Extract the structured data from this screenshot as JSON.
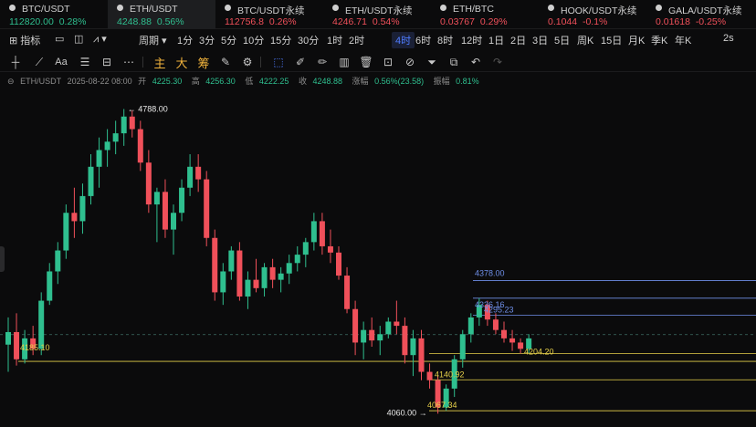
{
  "tickers": [
    {
      "symbol": "BTC/USDT",
      "price": "112820.00",
      "change": "0.28%",
      "dir": "up"
    },
    {
      "symbol": "ETH/USDT",
      "price": "4248.88",
      "change": "0.56%",
      "dir": "up"
    },
    {
      "symbol": "BTC/USDT永续",
      "price": "112756.8",
      "change": "0.26%",
      "dir": "dn"
    },
    {
      "symbol": "ETH/USDT永续",
      "price": "4246.71",
      "change": "0.54%",
      "dir": "dn"
    },
    {
      "symbol": "ETH/BTC",
      "price": "0.03767",
      "change": "0.29%",
      "dir": "dn"
    },
    {
      "symbol": "HOOK/USDT永续",
      "price": "0.1044",
      "change": "-0.1%",
      "dir": "dn"
    },
    {
      "symbol": "GALA/USDT永续",
      "price": "0.01618",
      "change": "-0.25%",
      "dir": "dn"
    }
  ],
  "toolbar": {
    "indicator_label": "指标",
    "period_label": "周期",
    "intervals": [
      "1分",
      "3分",
      "5分",
      "10分",
      "15分",
      "30分",
      "1时",
      "2时",
      "4时",
      "6时",
      "8时",
      "12时",
      "1日",
      "2日",
      "3日",
      "5日",
      "周K",
      "15日",
      "月K",
      "季K",
      "年K"
    ],
    "active_interval": "4时",
    "refresh": "2s",
    "draw_main": "主",
    "draw_big": "大",
    "draw_chip": "筹"
  },
  "ohlc": {
    "symbol": "ETH/USDT",
    "time": "2025-08-22 08:00",
    "open_label": "开",
    "open": "4225.30",
    "high_label": "高",
    "high": "4256.30",
    "low_label": "低",
    "low": "4222.25",
    "close_label": "收",
    "close": "4248.88",
    "change_label": "涨幅",
    "change": "0.56%(23.58)",
    "amp_label": "振幅",
    "amp": "0.81%"
  },
  "chart_data": {
    "type": "candlestick",
    "price_range": [
      4050,
      4800
    ],
    "price_ticks": [],
    "candles": [
      [
        4225,
        4290,
        4160,
        4255
      ],
      [
        4255,
        4300,
        4175,
        4190
      ],
      [
        4190,
        4260,
        4180,
        4240
      ],
      [
        4240,
        4270,
        4200,
        4215
      ],
      [
        4215,
        4350,
        4200,
        4330
      ],
      [
        4330,
        4420,
        4320,
        4400
      ],
      [
        4400,
        4470,
        4370,
        4450
      ],
      [
        4450,
        4560,
        4430,
        4540
      ],
      [
        4540,
        4600,
        4480,
        4520
      ],
      [
        4520,
        4610,
        4490,
        4580
      ],
      [
        4580,
        4680,
        4560,
        4650
      ],
      [
        4650,
        4720,
        4600,
        4690
      ],
      [
        4690,
        4740,
        4650,
        4710
      ],
      [
        4710,
        4760,
        4680,
        4730
      ],
      [
        4730,
        4788,
        4700,
        4770
      ],
      [
        4770,
        4785,
        4720,
        4740
      ],
      [
        4740,
        4760,
        4640,
        4660
      ],
      [
        4660,
        4690,
        4540,
        4560
      ],
      [
        4560,
        4600,
        4470,
        4590
      ],
      [
        4590,
        4620,
        4480,
        4500
      ],
      [
        4500,
        4560,
        4440,
        4540
      ],
      [
        4540,
        4620,
        4520,
        4600
      ],
      [
        4600,
        4680,
        4580,
        4650
      ],
      [
        4650,
        4680,
        4590,
        4620
      ],
      [
        4620,
        4640,
        4460,
        4480
      ],
      [
        4480,
        4500,
        4330,
        4350
      ],
      [
        4350,
        4420,
        4320,
        4400
      ],
      [
        4400,
        4460,
        4380,
        4450
      ],
      [
        4450,
        4470,
        4330,
        4340
      ],
      [
        4340,
        4400,
        4310,
        4380
      ],
      [
        4380,
        4430,
        4350,
        4360
      ],
      [
        4360,
        4420,
        4340,
        4410
      ],
      [
        4410,
        4430,
        4360,
        4380
      ],
      [
        4380,
        4410,
        4350,
        4395
      ],
      [
        4395,
        4440,
        4370,
        4420
      ],
      [
        4420,
        4460,
        4400,
        4440
      ],
      [
        4440,
        4480,
        4410,
        4470
      ],
      [
        4470,
        4540,
        4450,
        4520
      ],
      [
        4520,
        4540,
        4440,
        4460
      ],
      [
        4460,
        4500,
        4420,
        4445
      ],
      [
        4445,
        4460,
        4380,
        4390
      ],
      [
        4390,
        4410,
        4300,
        4310
      ],
      [
        4310,
        4330,
        4200,
        4230
      ],
      [
        4230,
        4280,
        4190,
        4260
      ],
      [
        4260,
        4290,
        4220,
        4235
      ],
      [
        4235,
        4270,
        4200,
        4250
      ],
      [
        4250,
        4290,
        4240,
        4280
      ],
      [
        4280,
        4330,
        4250,
        4270
      ],
      [
        4270,
        4290,
        4180,
        4200
      ],
      [
        4200,
        4260,
        4150,
        4240
      ],
      [
        4240,
        4260,
        4140,
        4160
      ],
      [
        4160,
        4180,
        4120,
        4140
      ],
      [
        4140,
        4150,
        4060,
        4075
      ],
      [
        4075,
        4130,
        4067,
        4120
      ],
      [
        4120,
        4200,
        4100,
        4190
      ],
      [
        4190,
        4260,
        4170,
        4250
      ],
      [
        4250,
        4300,
        4230,
        4290
      ],
      [
        4290,
        4336,
        4270,
        4320
      ],
      [
        4320,
        4330,
        4270,
        4285
      ],
      [
        4285,
        4300,
        4250,
        4260
      ],
      [
        4260,
        4280,
        4230,
        4240
      ],
      [
        4240,
        4260,
        4210,
        4230
      ],
      [
        4230,
        4240,
        4204,
        4215
      ],
      [
        4215,
        4250,
        4205,
        4240
      ]
    ],
    "levels": [
      {
        "label": "4378.00",
        "price": 4378,
        "color": "#6f8fe8"
      },
      {
        "label": "4336.16",
        "price": 4336,
        "color": "#6f8fe8"
      },
      {
        "label": "4295.23",
        "price": 4295,
        "color": "#6f8fe8"
      },
      {
        "label": "4204.20",
        "price": 4204,
        "color": "#e6d04a"
      },
      {
        "label": "4185.10",
        "price": 4185,
        "color": "#e6d04a"
      },
      {
        "label": "4140.92",
        "price": 4141,
        "color": "#e6d04a"
      },
      {
        "label": "4067.34",
        "price": 4067,
        "color": "#e6d04a"
      }
    ],
    "high_marker": "← 4788.00",
    "low_marker": "4060.00 →",
    "last_price": 4248.88
  }
}
